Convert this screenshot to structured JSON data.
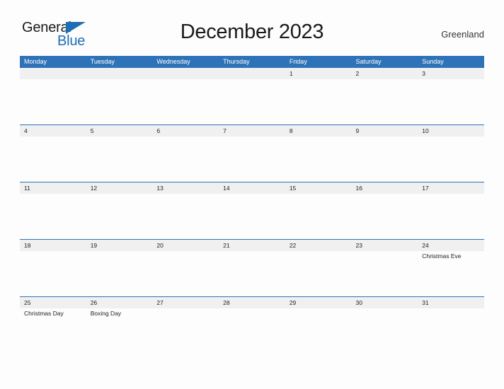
{
  "brand": {
    "name_part1": "General",
    "name_part2": "Blue",
    "triangle_color": "#1f6eb4"
  },
  "header": {
    "title": "December 2023",
    "region": "Greenland"
  },
  "theme": {
    "header_blue": "#2e72b8",
    "band_gray": "#f0f0f0",
    "page_background": "#fdfdfd",
    "text": "#222222"
  },
  "calendar": {
    "weekday_headers": [
      "Monday",
      "Tuesday",
      "Wednesday",
      "Thursday",
      "Friday",
      "Saturday",
      "Sunday"
    ],
    "weeks": [
      {
        "days": [
          {
            "num": "",
            "event": ""
          },
          {
            "num": "",
            "event": ""
          },
          {
            "num": "",
            "event": ""
          },
          {
            "num": "",
            "event": ""
          },
          {
            "num": "1",
            "event": ""
          },
          {
            "num": "2",
            "event": ""
          },
          {
            "num": "3",
            "event": ""
          }
        ]
      },
      {
        "days": [
          {
            "num": "4",
            "event": ""
          },
          {
            "num": "5",
            "event": ""
          },
          {
            "num": "6",
            "event": ""
          },
          {
            "num": "7",
            "event": ""
          },
          {
            "num": "8",
            "event": ""
          },
          {
            "num": "9",
            "event": ""
          },
          {
            "num": "10",
            "event": ""
          }
        ]
      },
      {
        "days": [
          {
            "num": "11",
            "event": ""
          },
          {
            "num": "12",
            "event": ""
          },
          {
            "num": "13",
            "event": ""
          },
          {
            "num": "14",
            "event": ""
          },
          {
            "num": "15",
            "event": ""
          },
          {
            "num": "16",
            "event": ""
          },
          {
            "num": "17",
            "event": ""
          }
        ]
      },
      {
        "days": [
          {
            "num": "18",
            "event": ""
          },
          {
            "num": "19",
            "event": ""
          },
          {
            "num": "20",
            "event": ""
          },
          {
            "num": "21",
            "event": ""
          },
          {
            "num": "22",
            "event": ""
          },
          {
            "num": "23",
            "event": ""
          },
          {
            "num": "24",
            "event": "Christmas Eve"
          }
        ]
      },
      {
        "days": [
          {
            "num": "25",
            "event": "Christmas Day"
          },
          {
            "num": "26",
            "event": "Boxing Day"
          },
          {
            "num": "27",
            "event": ""
          },
          {
            "num": "28",
            "event": ""
          },
          {
            "num": "29",
            "event": ""
          },
          {
            "num": "30",
            "event": ""
          },
          {
            "num": "31",
            "event": ""
          }
        ]
      }
    ]
  }
}
